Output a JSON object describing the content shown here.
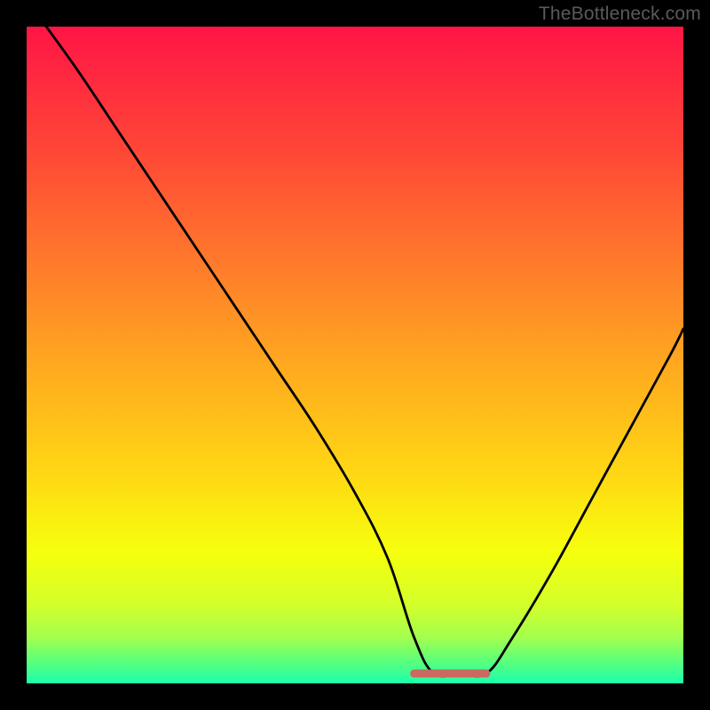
{
  "watermark": "TheBottleneck.com",
  "colors": {
    "frame": "#000000",
    "watermark_text": "#5a5a5a",
    "curve": "#000000",
    "marker_fill": "#cb6860",
    "gradient_stops": [
      {
        "offset": 0.0,
        "color": "#ff1546"
      },
      {
        "offset": 0.18,
        "color": "#ff4437"
      },
      {
        "offset": 0.36,
        "color": "#ff7a2b"
      },
      {
        "offset": 0.52,
        "color": "#ffaa1f"
      },
      {
        "offset": 0.68,
        "color": "#ffd714"
      },
      {
        "offset": 0.8,
        "color": "#f6ff0d"
      },
      {
        "offset": 0.88,
        "color": "#d3ff2a"
      },
      {
        "offset": 0.93,
        "color": "#a3ff4e"
      },
      {
        "offset": 0.965,
        "color": "#5dff7a"
      },
      {
        "offset": 1.0,
        "color": "#1bffad"
      }
    ]
  },
  "chart_data": {
    "type": "line",
    "title": "",
    "xlabel": "",
    "ylabel": "",
    "xlim": [
      0,
      100
    ],
    "ylim": [
      0,
      100
    ],
    "grid": false,
    "legend": false,
    "notes": "V-shaped bottleneck curve. Y ~100 = maximum mismatch (red), Y ~0 = optimal (green). Minimum plateau around x 59-70.",
    "series": [
      {
        "name": "bottleneck-curve",
        "x": [
          3,
          8,
          14,
          20,
          26,
          32,
          38,
          44,
          50,
          55,
          59,
          62,
          66,
          70,
          74,
          80,
          86,
          92,
          98,
          100
        ],
        "y": [
          100,
          93,
          84,
          75,
          66,
          57,
          48,
          39,
          29,
          19,
          7,
          1.5,
          1.5,
          1.5,
          7,
          17,
          28,
          39,
          50,
          54
        ]
      }
    ],
    "marker": {
      "name": "optimal-range",
      "x_start": 59,
      "x_end": 70,
      "y": 1.5
    }
  }
}
